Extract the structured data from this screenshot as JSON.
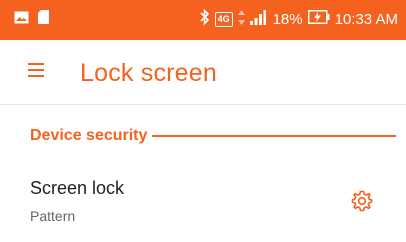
{
  "status_bar": {
    "network_type": "4G",
    "battery_percent": "18%",
    "time": "10:33 AM",
    "icons": [
      "photo-notification-icon",
      "sd-card-icon",
      "bluetooth-icon",
      "lte-icon",
      "data-arrows-icon",
      "signal-icon",
      "battery-charging-icon"
    ],
    "background_color": "#f5621f"
  },
  "toolbar": {
    "title": "Lock screen",
    "menu_icon": "hamburger-menu-icon",
    "accent_color": "#f5621f"
  },
  "section": {
    "title": "Device security"
  },
  "preference": {
    "title": "Screen lock",
    "summary": "Pattern",
    "action_icon": "gear-icon"
  }
}
